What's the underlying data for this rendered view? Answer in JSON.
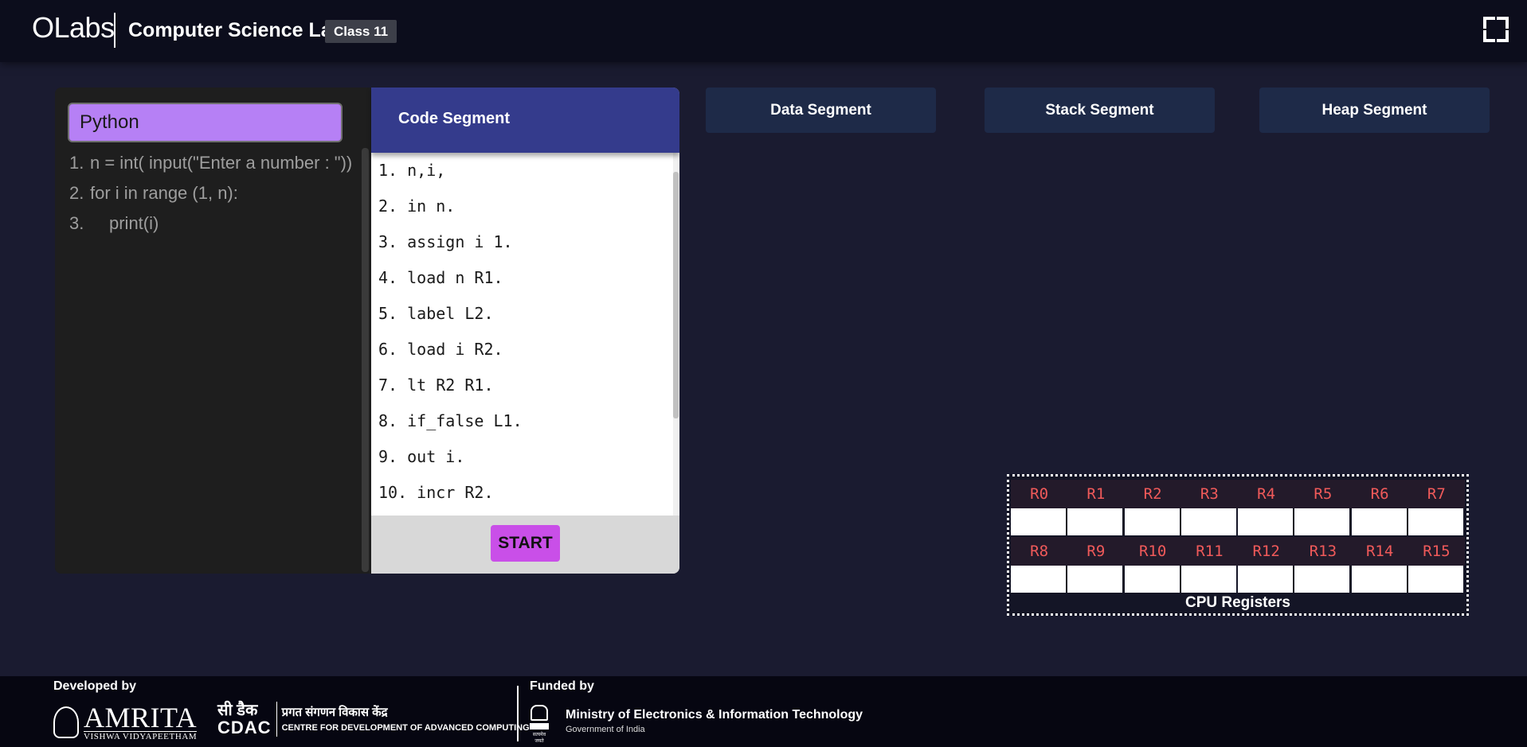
{
  "header": {
    "logo": "OLabs",
    "title": "Computer Science Lab",
    "class_badge": "Class 11",
    "fullscreen_icon": "fullscreen-icon"
  },
  "editor": {
    "language": "Python",
    "source_lines": [
      {
        "num": "1.",
        "text": "n = int( input(\"Enter a number : \"))"
      },
      {
        "num": "2.",
        "text": "for i in range (1, n):"
      },
      {
        "num": "3.",
        "text": "print(i)"
      }
    ]
  },
  "code_segment": {
    "title": "Code Segment",
    "lines": [
      "1. n,i,",
      "2. in n.",
      "3. assign i 1.",
      "4. load n R1.",
      "5. label L2.",
      "6. load i R2.",
      "7. lt R2 R1.",
      "8. if_false L1.",
      "9. out i.",
      "10. incr R2."
    ],
    "start_label": "START"
  },
  "segments": {
    "data": "Data Segment",
    "stack": "Stack Segment",
    "heap": "Heap Segment"
  },
  "registers": {
    "row1": [
      "R0",
      "R1",
      "R2",
      "R3",
      "R4",
      "R5",
      "R6",
      "R7"
    ],
    "row2": [
      "R8",
      "R9",
      "R10",
      "R11",
      "R12",
      "R13",
      "R14",
      "R15"
    ],
    "caption": "CPU Registers"
  },
  "footer": {
    "developed_by": "Developed by",
    "amrita_name": "AMRITA",
    "amrita_sub": "VISHWA VIDYAPEETHAM",
    "cdac_hindi": "सी डैक",
    "cdac_en": "CDAC",
    "cdac_line1": "प्रगत संगणन विकास केंद्र",
    "cdac_line2": "CENTRE FOR DEVELOPMENT OF ADVANCED COMPUTING",
    "funded_by": "Funded by",
    "ministry": "Ministry of Electronics & Information Technology",
    "govt": "Government of India",
    "emblem_text": "सत्यमेव जयते"
  }
}
